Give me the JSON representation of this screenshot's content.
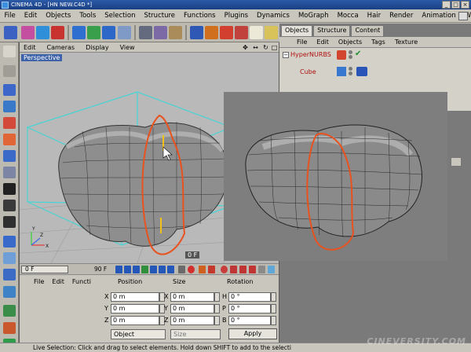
{
  "window": {
    "title": "CINEMA 4D - [HN NEW.C4D *]"
  },
  "menu": [
    "File",
    "Edit",
    "Objects",
    "Tools",
    "Selection",
    "Structure",
    "Functions",
    "Plugins",
    "Dynamics",
    "MoGraph",
    "Mocca",
    "Hair",
    "Render",
    "Animation",
    "Window"
  ],
  "viewport": {
    "menu": [
      "Edit",
      "Cameras",
      "Display",
      "View"
    ],
    "label": "Perspective",
    "frame": "0 F"
  },
  "object_manager": {
    "tabs": [
      "Objects",
      "Structure",
      "Content"
    ],
    "active_tab": "Objects",
    "menu": [
      "File",
      "Edit",
      "Objects",
      "Tags",
      "Texture"
    ],
    "tree": [
      "HyperNURBS",
      "Cube"
    ]
  },
  "timeline": {
    "start": "0 F",
    "end": "90 F"
  },
  "coordinates": {
    "menu": [
      "File",
      "Edit",
      "Functi"
    ],
    "headers": {
      "position": "Position",
      "size": "Size",
      "rotation": "Rotation"
    },
    "position": {
      "x": "0 m",
      "y": "0 m",
      "z": "0 m"
    },
    "size": {
      "x": "0 m",
      "y": "0 m",
      "z": "0 m"
    },
    "rotation": {
      "h": "0 °",
      "p": "0 °",
      "b": "0 °"
    },
    "axis_labels": {
      "x": "X",
      "y": "Y",
      "z": "Z",
      "h": "H",
      "p": "P",
      "b": "B"
    },
    "mode_dropdown": "Object",
    "size_dropdown": "Size",
    "apply": "Apply"
  },
  "status": "Live Selection: Click and drag to select elements. Hold down SHIFT to add to the selecti",
  "watermark": "CINEVERSITY.COM",
  "colors": {
    "accent": "#3f63a8",
    "wireframe": "#4ad6d6",
    "selection": "#e8521f"
  }
}
